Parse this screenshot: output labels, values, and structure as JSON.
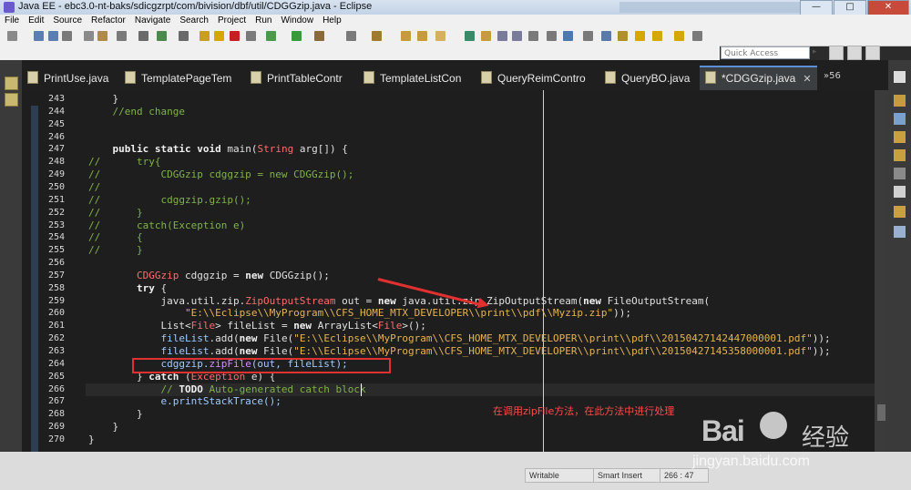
{
  "window": {
    "title": "Java EE - ebc3.0-nt-baks/sdicgzrpt/com/bivision/dbf/util/CDGGzip.java - Eclipse",
    "minimize": "—",
    "maximize": "□",
    "close": "✕"
  },
  "menu": [
    "File",
    "Edit",
    "Source",
    "Refactor",
    "Navigate",
    "Search",
    "Project",
    "Run",
    "Window",
    "Help"
  ],
  "quick_access": {
    "placeholder": "Quick Access"
  },
  "tabs": [
    {
      "label": "PrintUse.java"
    },
    {
      "label": "TemplatePageTem"
    },
    {
      "label": "PrintTableContr"
    },
    {
      "label": "TemplateListCon"
    },
    {
      "label": "QueryReimContro"
    },
    {
      "label": "QueryBO.java"
    },
    {
      "label": "*CDGGzip.java",
      "active": true,
      "close": "✕"
    }
  ],
  "tab_overflow": "»56",
  "code_lines": [
    {
      "n": "243",
      "segs": [
        {
          "t": "    }",
          "c": ""
        }
      ]
    },
    {
      "n": "244",
      "segs": [
        {
          "t": "    //end change",
          "c": "cm"
        }
      ]
    },
    {
      "n": "245",
      "segs": []
    },
    {
      "n": "246",
      "segs": []
    },
    {
      "n": "247",
      "segs": [
        {
          "t": "    ",
          "c": ""
        },
        {
          "t": "public static void ",
          "c": "kw"
        },
        {
          "t": "main(",
          "c": ""
        },
        {
          "t": "String",
          "c": "ty"
        },
        {
          "t": " arg[]) {",
          "c": ""
        }
      ]
    },
    {
      "n": "248",
      "segs": [
        {
          "t": "//      try{",
          "c": "cm"
        }
      ]
    },
    {
      "n": "249",
      "segs": [
        {
          "t": "//          CDGGzip cdggzip = new CDGGzip();",
          "c": "cm"
        }
      ]
    },
    {
      "n": "250",
      "segs": [
        {
          "t": "//",
          "c": "cm"
        }
      ]
    },
    {
      "n": "251",
      "segs": [
        {
          "t": "//          cdggzip.gzip();",
          "c": "cm"
        }
      ]
    },
    {
      "n": "252",
      "segs": [
        {
          "t": "//      }",
          "c": "cm"
        }
      ]
    },
    {
      "n": "253",
      "segs": [
        {
          "t": "//      catch(Exception e)",
          "c": "cm"
        }
      ]
    },
    {
      "n": "254",
      "segs": [
        {
          "t": "//      {",
          "c": "cm"
        }
      ]
    },
    {
      "n": "255",
      "segs": [
        {
          "t": "//      }",
          "c": "cm"
        }
      ]
    },
    {
      "n": "256",
      "segs": []
    },
    {
      "n": "257",
      "segs": [
        {
          "t": "        ",
          "c": ""
        },
        {
          "t": "CDGGzip",
          "c": "ty"
        },
        {
          "t": " cdggzip = ",
          "c": ""
        },
        {
          "t": "new ",
          "c": "kw"
        },
        {
          "t": "CDGGzip();",
          "c": ""
        }
      ]
    },
    {
      "n": "258",
      "segs": [
        {
          "t": "        ",
          "c": ""
        },
        {
          "t": "try",
          "c": "kw"
        },
        {
          "t": " {",
          "c": ""
        }
      ]
    },
    {
      "n": "259",
      "segs": [
        {
          "t": "            java.util.zip.",
          "c": ""
        },
        {
          "t": "ZipOutputStream",
          "c": "ty"
        },
        {
          "t": " out = ",
          "c": ""
        },
        {
          "t": "new ",
          "c": "kw"
        },
        {
          "t": "java.util.zip.ZipOutputStream(",
          "c": ""
        },
        {
          "t": "new ",
          "c": "kw"
        },
        {
          "t": "FileOutputStream(",
          "c": ""
        }
      ]
    },
    {
      "n": "260",
      "segs": [
        {
          "t": "                ",
          "c": ""
        },
        {
          "t": "\"E:\\\\Eclipse\\\\MyProgram\\\\CFS_HOME_MTX_DEVELOPER\\\\print\\\\pdf\\\\Myzip.zip\"",
          "c": "st"
        },
        {
          "t": "));",
          "c": ""
        }
      ]
    },
    {
      "n": "261",
      "segs": [
        {
          "t": "            List<",
          "c": ""
        },
        {
          "t": "File",
          "c": "ty"
        },
        {
          "t": "> fileList = ",
          "c": ""
        },
        {
          "t": "new ",
          "c": "kw"
        },
        {
          "t": "ArrayList<",
          "c": ""
        },
        {
          "t": "File",
          "c": "ty"
        },
        {
          "t": ">();",
          "c": ""
        }
      ]
    },
    {
      "n": "262",
      "segs": [
        {
          "t": "            fileList",
          "c": "vr"
        },
        {
          "t": ".add(",
          "c": ""
        },
        {
          "t": "new ",
          "c": "kw"
        },
        {
          "t": "File(",
          "c": ""
        },
        {
          "t": "\"E:\\\\Eclipse\\\\MyProgram\\\\CFS_HOME_MTX_DEVELOPER\\\\print\\\\pdf\\\\20150427142447000001.pdf\"",
          "c": "st"
        },
        {
          "t": "));",
          "c": ""
        }
      ]
    },
    {
      "n": "263",
      "segs": [
        {
          "t": "            fileList",
          "c": "vr"
        },
        {
          "t": ".add(",
          "c": ""
        },
        {
          "t": "new ",
          "c": "kw"
        },
        {
          "t": "File(",
          "c": ""
        },
        {
          "t": "\"E:\\\\Eclipse\\\\MyProgram\\\\CFS_HOME_MTX_DEVELOPER\\\\print\\\\pdf\\\\20150427145358000001.pdf\"",
          "c": "st"
        },
        {
          "t": "));",
          "c": ""
        }
      ]
    },
    {
      "n": "264",
      "segs": [
        {
          "t": "            cdggzip.",
          "c": "vr"
        },
        {
          "t": "zipFile",
          "c": "gn"
        },
        {
          "t": "(out, fileList);",
          "c": "vr"
        }
      ]
    },
    {
      "n": "265",
      "segs": [
        {
          "t": "        } ",
          "c": ""
        },
        {
          "t": "catch",
          "c": "kw"
        },
        {
          "t": " (",
          "c": ""
        },
        {
          "t": "Exception",
          "c": "ty"
        },
        {
          "t": " e) {",
          "c": ""
        }
      ]
    },
    {
      "n": "266",
      "segs": [
        {
          "t": "            // ",
          "c": "cm"
        },
        {
          "t": "TODO",
          "c": "kw"
        },
        {
          "t": " Auto-generated catch block",
          "c": "cm"
        }
      ]
    },
    {
      "n": "267",
      "segs": [
        {
          "t": "            e.printStackTrace();",
          "c": "vr"
        }
      ]
    },
    {
      "n": "268",
      "segs": [
        {
          "t": "        }",
          "c": ""
        }
      ]
    },
    {
      "n": "269",
      "segs": [
        {
          "t": "    }",
          "c": ""
        }
      ]
    },
    {
      "n": "270",
      "segs": [
        {
          "t": "}",
          "c": ""
        }
      ]
    }
  ],
  "annotation": "在调用zipFile方法，在此方法中进行处理",
  "status": {
    "writable": "Writable",
    "insert_mode": "Smart Insert",
    "position": "266 : 47"
  },
  "watermark": {
    "brand": "Bai",
    "brand_cn": "经验",
    "url": "jingyan.baidu.com"
  },
  "colors": {
    "comment": "#7fb347",
    "string": "#e6b450",
    "type": "#ff6b6b",
    "highlight": "#e03030"
  }
}
